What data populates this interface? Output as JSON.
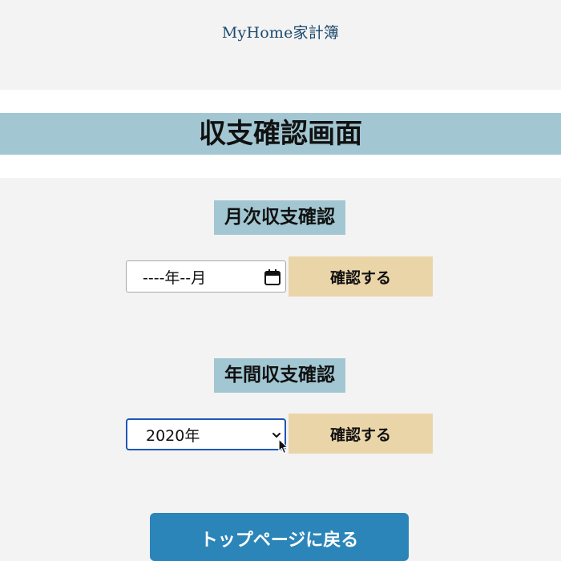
{
  "header": {
    "app_title": "MyHome家計簿"
  },
  "page": {
    "title": "収支確認画面"
  },
  "monthly": {
    "heading": "月次収支確認",
    "input_display": "----年--月",
    "button_label": "確認する"
  },
  "yearly": {
    "heading": "年間収支確認",
    "selected": "2020年",
    "button_label": "確認する"
  },
  "footer": {
    "top_button_label": "トップページに戻る"
  },
  "colors": {
    "background": "#f3f3f3",
    "heading_bg": "#a2c7d2",
    "confirm_button_bg": "#ead5a9",
    "top_button_bg": "#2b85b9",
    "app_title": "#1d4a6e",
    "select_focus_border": "#1f56b8"
  },
  "icons": {
    "calendar": "calendar-icon",
    "select_arrow": "chevron-down-icon",
    "cursor": "mouse-pointer-icon"
  }
}
